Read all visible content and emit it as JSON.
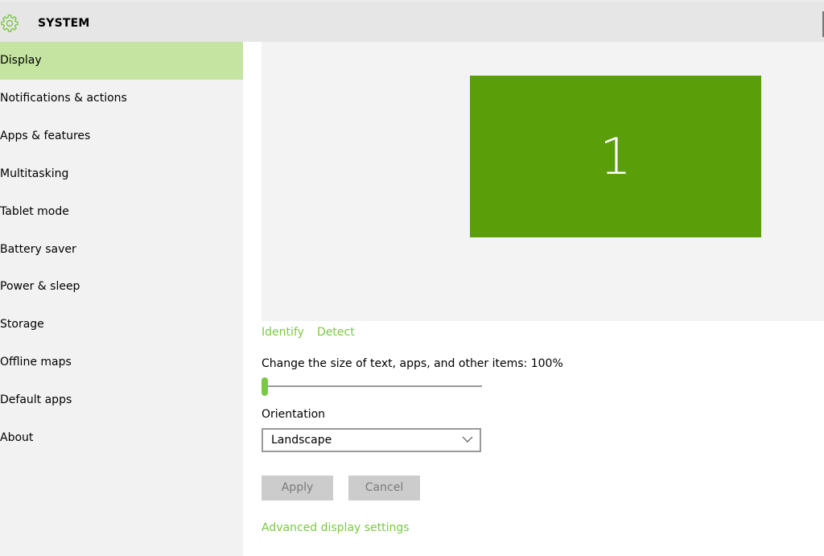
{
  "header": {
    "title": "SYSTEM",
    "icon": "gear-icon"
  },
  "sidebar": {
    "items": [
      {
        "label": "Display",
        "selected": true
      },
      {
        "label": "Notifications & actions"
      },
      {
        "label": "Apps & features"
      },
      {
        "label": "Multitasking"
      },
      {
        "label": "Tablet mode"
      },
      {
        "label": "Battery saver"
      },
      {
        "label": "Power & sleep"
      },
      {
        "label": "Storage"
      },
      {
        "label": "Offline maps"
      },
      {
        "label": "Default apps"
      },
      {
        "label": "About"
      }
    ]
  },
  "display": {
    "monitor_number": "1",
    "identify_label": "Identify",
    "detect_label": "Detect",
    "scale_label": "Change the size of text, apps, and other items: 100%",
    "scale_slider_value_percent": 0,
    "orientation_label": "Orientation",
    "orientation_value": "Landscape",
    "apply_label": "Apply",
    "cancel_label": "Cancel",
    "advanced_label": "Advanced display settings"
  },
  "colors": {
    "accent": "#7ac943",
    "selected_bg": "#c5e3a1",
    "monitor": "#5a9e0a"
  }
}
